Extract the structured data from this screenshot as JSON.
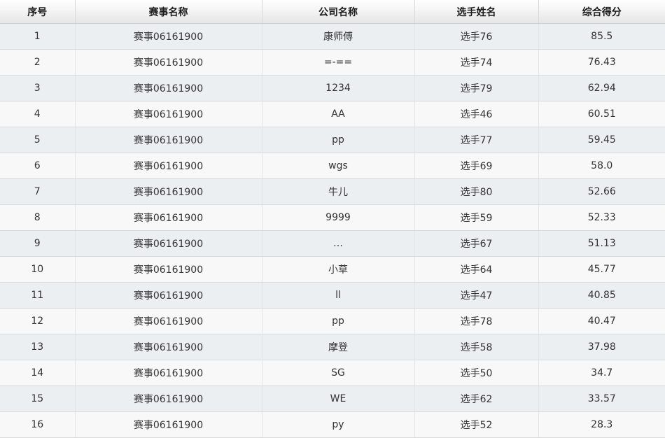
{
  "table": {
    "headers": [
      "序号",
      "赛事名称",
      "公司名称",
      "选手姓名",
      "综合得分"
    ],
    "rows": [
      [
        "1",
        "赛事06161900",
        "康师傅",
        "选手76",
        "85.5"
      ],
      [
        "2",
        "赛事06161900",
        "=-==",
        "选手74",
        "76.43"
      ],
      [
        "3",
        "赛事06161900",
        "1234",
        "选手79",
        "62.94"
      ],
      [
        "4",
        "赛事06161900",
        "AA",
        "选手46",
        "60.51"
      ],
      [
        "5",
        "赛事06161900",
        "pp",
        "选手77",
        "59.45"
      ],
      [
        "6",
        "赛事06161900",
        "wgs",
        "选手69",
        "58.0"
      ],
      [
        "7",
        "赛事06161900",
        "牛儿",
        "选手80",
        "52.66"
      ],
      [
        "8",
        "赛事06161900",
        "9999",
        "选手59",
        "52.33"
      ],
      [
        "9",
        "赛事06161900",
        "…",
        "选手67",
        "51.13"
      ],
      [
        "10",
        "赛事06161900",
        "小草",
        "选手64",
        "45.77"
      ],
      [
        "11",
        "赛事06161900",
        "ll",
        "选手47",
        "40.85"
      ],
      [
        "12",
        "赛事06161900",
        "pp",
        "选手78",
        "40.47"
      ],
      [
        "13",
        "赛事06161900",
        "摩登",
        "选手58",
        "37.98"
      ],
      [
        "14",
        "赛事06161900",
        "SG",
        "选手50",
        "34.7"
      ],
      [
        "15",
        "赛事06161900",
        "WE",
        "选手62",
        "33.57"
      ],
      [
        "16",
        "赛事06161900",
        "py",
        "选手52",
        "28.3"
      ]
    ]
  }
}
